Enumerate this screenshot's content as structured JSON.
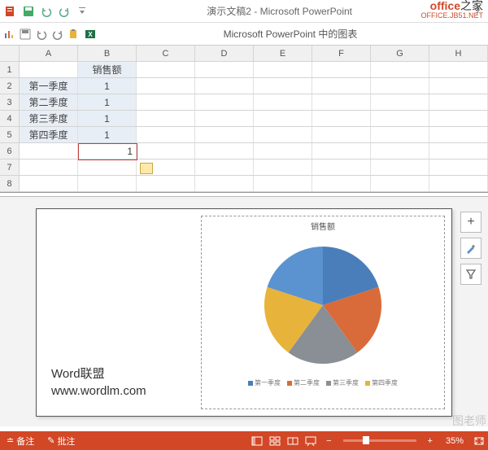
{
  "title_bar": {
    "app_title": "演示文稿2 - Microsoft PowerPoint",
    "help": "?"
  },
  "brand": {
    "part1": "office",
    "part2": "之家",
    "url": "OFFICE.JB51.NET"
  },
  "sub_bar": {
    "title": "Microsoft PowerPoint 中的图表"
  },
  "sheet": {
    "cols": [
      "A",
      "B",
      "C",
      "D",
      "E",
      "F",
      "G",
      "H"
    ],
    "rows": [
      {
        "n": "1",
        "a": "",
        "b": "销售额"
      },
      {
        "n": "2",
        "a": "第一季度",
        "b": "1"
      },
      {
        "n": "3",
        "a": "第二季度",
        "b": "1"
      },
      {
        "n": "4",
        "a": "第三季度",
        "b": "1"
      },
      {
        "n": "5",
        "a": "第四季度",
        "b": "1"
      },
      {
        "n": "6",
        "a": "",
        "b": "1"
      },
      {
        "n": "7",
        "a": "",
        "b": ""
      },
      {
        "n": "8",
        "a": "",
        "b": ""
      }
    ]
  },
  "chart_data": {
    "type": "pie",
    "title": "销售额",
    "categories": [
      "第一季度",
      "第二季度",
      "第三季度",
      "第四季度",
      ""
    ],
    "values": [
      1,
      1,
      1,
      1,
      1
    ],
    "colors": [
      "#4a7ebb",
      "#d96b3a",
      "#8a8f96",
      "#e8b33a",
      "#5a93cf"
    ]
  },
  "text_block": {
    "line1": "Word联盟",
    "line2": "www.wordlm.com"
  },
  "status": {
    "notes": "备注",
    "comments": "批注",
    "zoom_label": "35%",
    "zoom_minus": "−",
    "zoom_plus": "+"
  },
  "side_tools": {
    "add": "+"
  },
  "watermark": "图老师"
}
